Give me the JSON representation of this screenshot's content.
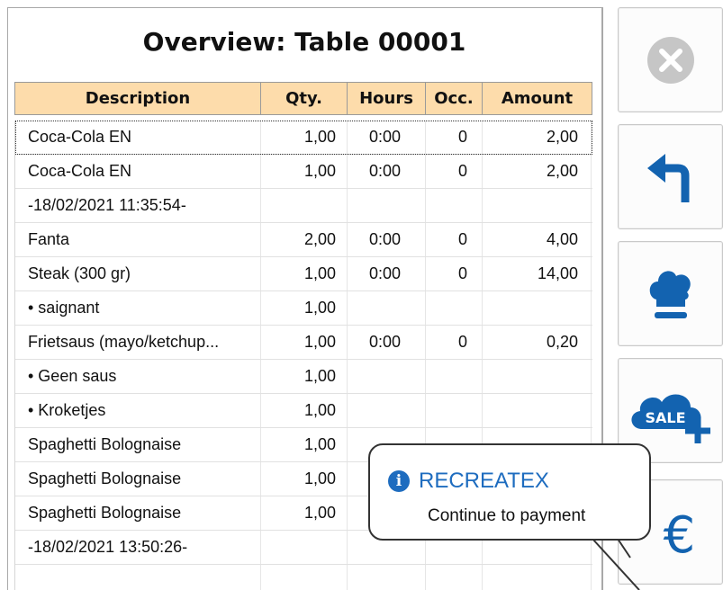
{
  "overview": {
    "title": "Overview: Table 00001"
  },
  "grid": {
    "columns": [
      "Description",
      "Qty.",
      "Hours",
      "Occ.",
      "Amount"
    ],
    "rows": [
      {
        "desc": "Coca-Cola EN",
        "qty": "1,00",
        "hours": "0:00",
        "occ": "0",
        "amount": "2,00"
      },
      {
        "desc": "Coca-Cola EN",
        "qty": "1,00",
        "hours": "0:00",
        "occ": "0",
        "amount": "2,00"
      },
      {
        "desc": "-18/02/2021 11:35:54-",
        "qty": "",
        "hours": "",
        "occ": "",
        "amount": ""
      },
      {
        "desc": "Fanta",
        "qty": "2,00",
        "hours": "0:00",
        "occ": "0",
        "amount": "4,00"
      },
      {
        "desc": "Steak (300 gr)",
        "qty": "1,00",
        "hours": "0:00",
        "occ": "0",
        "amount": "14,00"
      },
      {
        "desc": "• saignant",
        "qty": "1,00",
        "hours": "",
        "occ": "",
        "amount": ""
      },
      {
        "desc": "Frietsaus (mayo/ketchup...",
        "qty": "1,00",
        "hours": "0:00",
        "occ": "0",
        "amount": "0,20"
      },
      {
        "desc": "• Geen saus",
        "qty": "1,00",
        "hours": "",
        "occ": "",
        "amount": ""
      },
      {
        "desc": "• Kroketjes",
        "qty": "1,00",
        "hours": "",
        "occ": "",
        "amount": ""
      },
      {
        "desc": "Spaghetti Bolognaise",
        "qty": "1,00",
        "hours": "",
        "occ": "",
        "amount": ""
      },
      {
        "desc": "Spaghetti Bolognaise",
        "qty": "1,00",
        "hours": "",
        "occ": "",
        "amount": ""
      },
      {
        "desc": "Spaghetti Bolognaise",
        "qty": "1,00",
        "hours": "",
        "occ": "",
        "amount": ""
      },
      {
        "desc": "-18/02/2021 13:50:26-",
        "qty": "",
        "hours": "",
        "occ": "",
        "amount": ""
      },
      {
        "desc": "",
        "qty": "",
        "hours": "",
        "occ": "",
        "amount": ""
      }
    ]
  },
  "side_buttons": {
    "close_icon": "close-circle-icon",
    "back_icon": "return-arrow-icon",
    "chef_icon": "chef-hat-icon",
    "sale_icon": "cloud-sale-plus-icon",
    "sale_label": "SALE",
    "payment_symbol": "€"
  },
  "tooltip": {
    "title": "RECREATEX",
    "text": "Continue to payment",
    "icon": "info-icon"
  },
  "colors": {
    "header_bg": "#fddcab",
    "accent_blue": "#1363b0",
    "icon_grey": "#c9c9c9"
  }
}
